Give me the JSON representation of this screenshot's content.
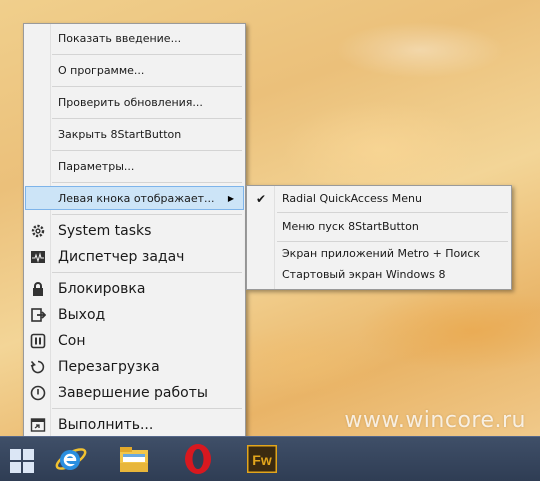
{
  "menu": {
    "items": [
      {
        "label": "Показать введение..."
      },
      {
        "label": "О программе..."
      },
      {
        "label": "Проверить обновления..."
      },
      {
        "label": "Закрыть 8StartButton"
      },
      {
        "label": "Параметры..."
      },
      {
        "label": "Левая кнока отображает..."
      },
      {
        "label": "System tasks",
        "icon": "gear-icon"
      },
      {
        "label": "Диспетчер задач",
        "icon": "task-manager-icon"
      },
      {
        "label": "Блокировка",
        "icon": "lock-icon"
      },
      {
        "label": "Выход",
        "icon": "sign-out-icon"
      },
      {
        "label": "Сон",
        "icon": "pause-icon"
      },
      {
        "label": "Перезагрузка",
        "icon": "restart-icon"
      },
      {
        "label": "Завершение работы",
        "icon": "shutdown-icon"
      },
      {
        "label": "Выполнить...",
        "icon": "run-icon"
      }
    ]
  },
  "submenu": {
    "items": [
      {
        "label": "Radial QuickAccess Menu",
        "checked": true
      },
      {
        "label": "Меню пуск 8StartButton",
        "checked": false
      },
      {
        "label": "Экран приложений Metro + Поиск",
        "checked": false
      },
      {
        "label": "Стартовый экран Windows 8",
        "checked": false
      }
    ]
  },
  "taskbar": {
    "items": [
      "start-button",
      "internet-explorer-icon",
      "file-explorer-icon",
      "opera-icon",
      "fireworks-icon"
    ],
    "fireworks_label": "Fw"
  },
  "watermark": "www.wincore.ru"
}
